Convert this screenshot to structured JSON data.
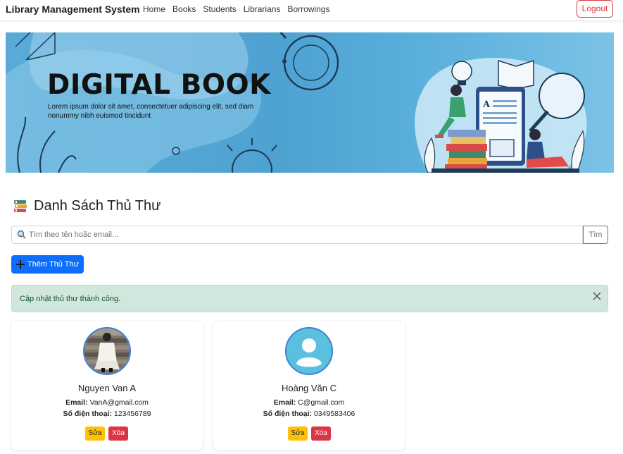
{
  "navbar": {
    "brand": "Library Management System",
    "links": [
      "Home",
      "Books",
      "Students",
      "Librarians",
      "Borrowings"
    ],
    "logout_label": "Logout"
  },
  "banner": {
    "title": "DIGITAL BOOK",
    "subtitle": "Lorem ipsum dolor sit amet, consectetuer adipiscing elit, sed diam nonummy nibh euismod tincidunt"
  },
  "page": {
    "title": "Danh Sách Thủ Thư",
    "title_icon": "books-icon"
  },
  "search": {
    "placeholder": "Tìm theo tên hoặc email...",
    "value": "",
    "button_label": "Tìm"
  },
  "add_button": {
    "label": "Thêm Thủ Thư",
    "icon": "plus-icon"
  },
  "alert": {
    "message": "Cập nhật thủ thư thành công.",
    "color": "#d1e7dd"
  },
  "librarians": [
    {
      "name": "Nguyen Van A",
      "email_label": "Email:",
      "email": "VanA@gmail.com",
      "phone_label": "Số điện thoại:",
      "phone": "123456789",
      "avatar": "photo",
      "edit_label": "Sửa",
      "delete_label": "Xóa"
    },
    {
      "name": "Hoàng Văn C",
      "email_label": "Email:",
      "email": "C@gmail.com",
      "phone_label": "Số điện thoại:",
      "phone": "0349583406",
      "avatar": "default-user-icon",
      "edit_label": "Sửa",
      "delete_label": "Xóa"
    }
  ],
  "colors": {
    "primary": "#0d6efd",
    "danger": "#dc3545",
    "warning": "#ffc107",
    "success_bg": "#d1e7dd"
  }
}
